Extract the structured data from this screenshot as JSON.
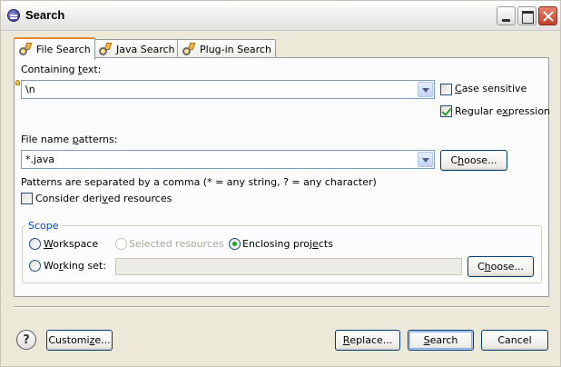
{
  "window": {
    "title": "Search"
  },
  "tabs": [
    {
      "label": "File Search",
      "icon": "file-search-icon",
      "active": true
    },
    {
      "label": "Java Search",
      "icon": "java-search-icon",
      "active": false
    },
    {
      "label": "Plug-in Search",
      "icon": "plugin-search-icon",
      "active": false
    }
  ],
  "containing_text": {
    "label_pre": "Containing ",
    "label_ul": "t",
    "label_post": "ext:",
    "value": "\\n",
    "case_sensitive": {
      "pre": "",
      "ul": "C",
      "post": "ase sensitive",
      "checked": false
    },
    "regex": {
      "pre": "Regular e",
      "ul": "x",
      "post": "pression",
      "checked": true
    }
  },
  "file_patterns": {
    "label_pre": "File name ",
    "label_ul": "p",
    "label_post": "atterns:",
    "value": "*.java",
    "choose": {
      "pre": "C",
      "ul": "h",
      "post": "oose..."
    },
    "hint": "Patterns are separated by a comma (* = any string, ? = any character)",
    "derived": {
      "pre": "Consider deri",
      "ul": "v",
      "post": "ed resources",
      "checked": false
    }
  },
  "scope": {
    "title": "Scope",
    "workspace": {
      "pre": "",
      "ul": "W",
      "post": "orkspace",
      "selected": false
    },
    "selected_resources": {
      "label": "Selected resources",
      "enabled": false
    },
    "enclosing_projects": {
      "pre": "Enclosing proj",
      "ul": "e",
      "post": "cts",
      "selected": true
    },
    "working_set": {
      "pre": "Wo",
      "ul": "r",
      "post": "king set:",
      "selected": false
    },
    "working_set_value": "",
    "choose": {
      "pre": "C",
      "ul": "h",
      "post": "oose..."
    }
  },
  "footer": {
    "help": "?",
    "customize": {
      "pre": "Customi",
      "ul": "z",
      "post": "e..."
    },
    "replace": {
      "pre": "",
      "ul": "R",
      "post": "eplace..."
    },
    "search": {
      "pre": "",
      "ul": "S",
      "post": "earch"
    },
    "cancel": "Cancel"
  }
}
